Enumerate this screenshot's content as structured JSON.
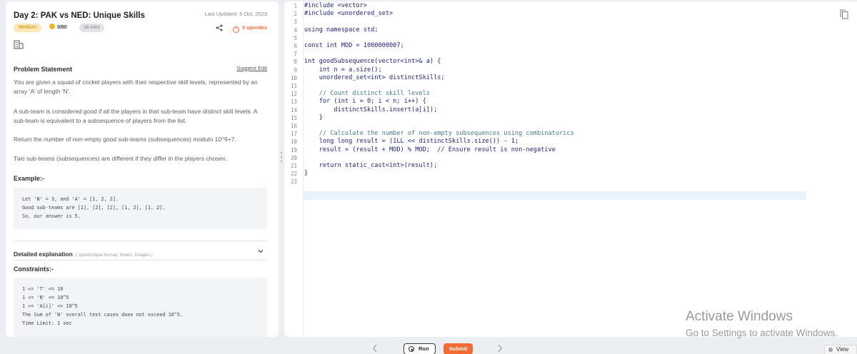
{
  "problem": {
    "title": "Day 2: PAK vs NED: Unique Skills",
    "last_updated": "Last Updated: 6 Oct, 2023",
    "difficulty": "Medium",
    "score": "0/80",
    "time": "18 mins",
    "upvotes": "0 upvotes",
    "statement_heading": "Problem Statement",
    "suggest_edit": "Suggest Edit",
    "paragraphs": [
      "You are given a squad of cricket players with their respective skill levels, represented by an array 'A' of length 'N'.",
      "A sub-team is considered good if all the players in that sub-team have distinct skill levels. A sub-team is equivalent to a subsequence of players from the list.",
      "Return the number of non-empty good sub-teams (subsequences) modulo 10^9+7.",
      "Two sub-teams (subsequences) are different if they differ in the players chosen."
    ],
    "example_heading": "Example:-",
    "example_lines": [
      "Let 'N' = 3, and 'A' = [1, 2, 2].",
      "Good sub-teams are [1], [2], [2], [1, 2], [1, 2].",
      "So, our answer is 5."
    ],
    "detail_title": "Detailed explanation",
    "detail_sub": "( Input/output format, Notes, Images )",
    "constraints_heading": "Constraints:-",
    "constraint_lines": [
      "1 <= 'T' <= 10",
      "1 <= 'N' <= 10^5",
      "1 <= 'A[i]' <= 10^5",
      "",
      "The Sum of 'N' overall test cases does not exceed 10^5.",
      "Time Limit: 1 sec"
    ]
  },
  "editor": {
    "line_numbers": [
      "1",
      "2",
      "3",
      "4",
      "5",
      "6",
      "7",
      "8",
      "9",
      "10",
      "11",
      "12",
      "13",
      "14",
      "15",
      "16",
      "17",
      "18",
      "19",
      "20",
      "21",
      "22",
      "23"
    ],
    "code_lines": [
      "#include <vector>",
      "#include <unordered_set>",
      "",
      "using namespace std;",
      "",
      "const int MOD = 1000000007;",
      "",
      "int goodSubsequence(vector<int>& a) {",
      "    int n = a.size();",
      "    unordered_set<int> distinctSkills;",
      "",
      "    // Count distinct skill levels",
      "    for (int i = 0; i < n; i++) {",
      "        distinctSkills.insert(a[i]);",
      "    }",
      "",
      "    // Calculate the number of non-empty subsequences using combinatorics",
      "    long long result = (1LL << distinctSkills.size()) - 1;",
      "    result = (result + MOD) % MOD;  // Ensure result is non-negative",
      "",
      "    return static_cast<int>(result);",
      "}",
      ""
    ]
  },
  "toolbar": {
    "run_label": "Run",
    "submit_label": "Submit",
    "view_label": "View"
  },
  "watermark": {
    "title": "Activate Windows",
    "subtitle": "Go to Settings to activate Windows."
  },
  "colors": {
    "accent": "#f36b32",
    "medium_badge_bg": "#fbe9b8",
    "medium_badge_text": "#c98a00"
  },
  "icons": [
    "share-icon",
    "upvote-icon",
    "company-icon",
    "chevron-down-icon",
    "copy-icon",
    "play-icon",
    "gear-icon",
    "chevron-left-icon",
    "chevron-right-icon"
  ]
}
